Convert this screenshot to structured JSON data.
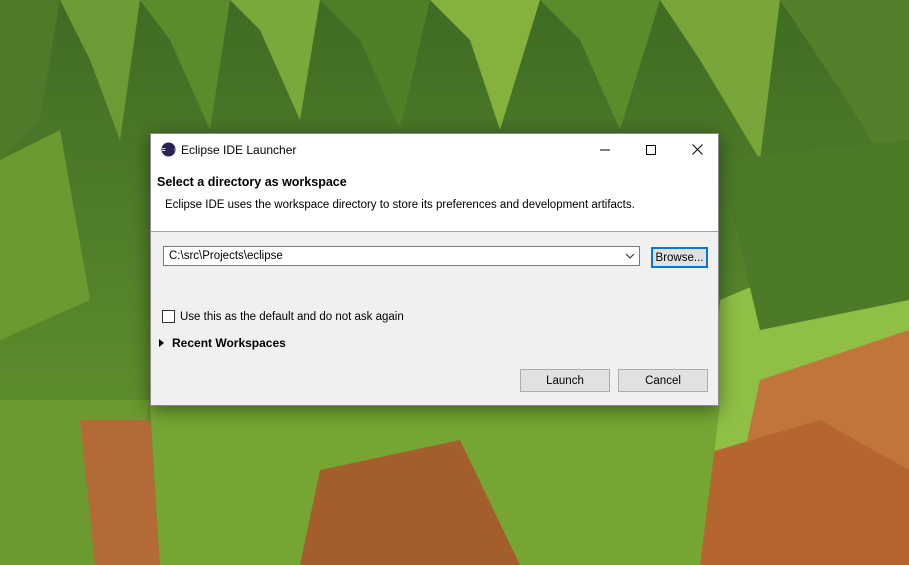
{
  "window": {
    "title": "Eclipse IDE Launcher",
    "controls": {
      "minimize": "minimize-icon",
      "maximize": "maximize-icon",
      "close": "close-icon"
    }
  },
  "header": {
    "title": "Select a directory as workspace",
    "description": "Eclipse IDE uses the workspace directory to store its preferences and development artifacts."
  },
  "workspace": {
    "value": "C:\\src\\Projects\\eclipse",
    "browse_label": "Browse..."
  },
  "default_checkbox": {
    "label": "Use this as the default and do not ask again",
    "checked": false
  },
  "recent": {
    "label": "Recent Workspaces",
    "expanded": false
  },
  "actions": {
    "launch_label": "Launch",
    "cancel_label": "Cancel"
  },
  "colors": {
    "focus_border": "#0078d7",
    "dialog_bg": "#f0f0f0",
    "eclipse_brand": "#2c2255"
  }
}
